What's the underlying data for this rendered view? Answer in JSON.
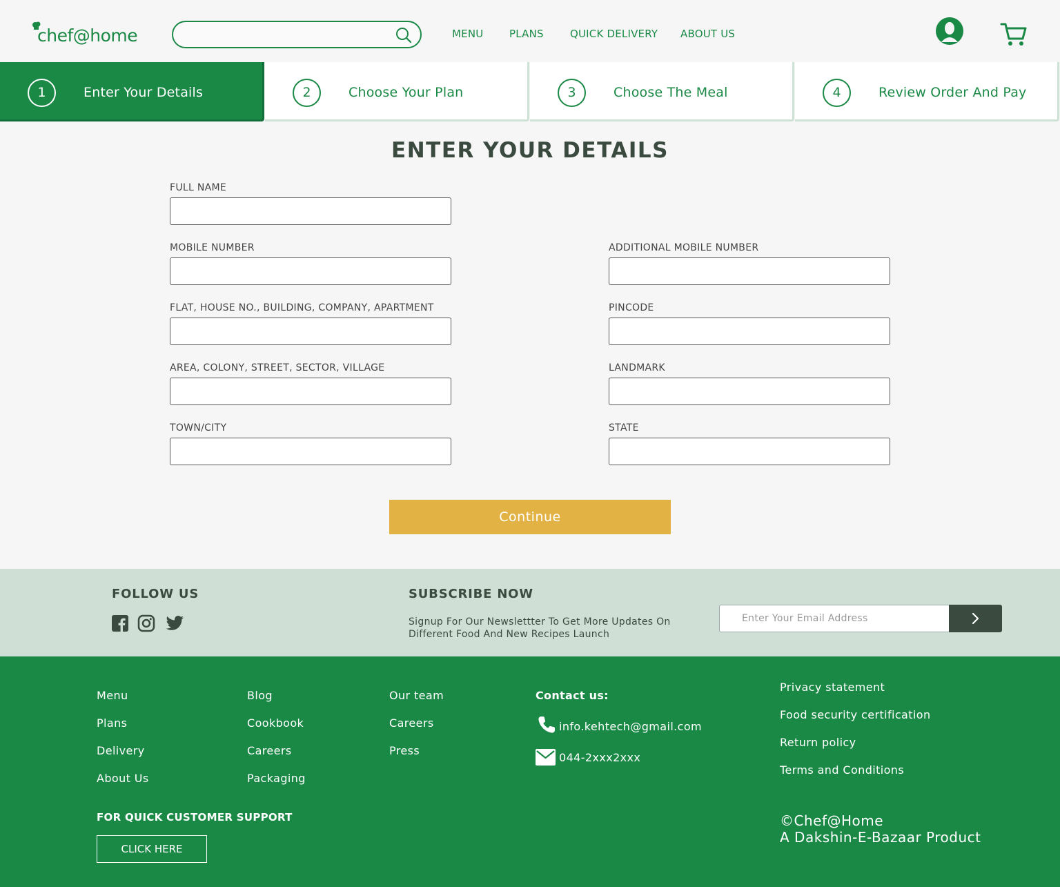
{
  "header": {
    "logo": "chef@home",
    "search": {
      "value": "",
      "placeholder": ""
    },
    "nav": [
      "MENU",
      "PLANS",
      "QUICK DELIVERY",
      "ABOUT US"
    ]
  },
  "steps": [
    {
      "num": "1",
      "label": "Enter Your Details",
      "active": true
    },
    {
      "num": "2",
      "label": "Choose Your Plan",
      "active": false
    },
    {
      "num": "3",
      "label": "Choose The Meal",
      "active": false
    },
    {
      "num": "4",
      "label": "Review Order And Pay",
      "active": false
    }
  ],
  "form": {
    "title": "ENTER YOUR DETAILS",
    "fields": {
      "full_name": "FULL NAME",
      "mobile": "MOBILE NUMBER",
      "additional_mobile": "ADDITIONAL MOBILE NUMBER",
      "flat": "FLAT, HOUSE NO., BUILDING, COMPANY, APARTMENT",
      "pincode": "PINCODE",
      "area": "AREA, COLONY, STREET, SECTOR, VILLAGE",
      "landmark": "LANDMARK",
      "town": "TOWN/CITY",
      "state": "STATE"
    },
    "continue_label": "Continue"
  },
  "band": {
    "follow_title": "FOLLOW US",
    "subscribe_title": "SUBSCRIBE NOW",
    "subscribe_text": "Signup For Our Newslettter To Get More Updates On Different Food And New Recipes Launch",
    "email_placeholder": "Enter Your Email Address"
  },
  "footer": {
    "col1": [
      "Menu",
      "Plans",
      "Delivery",
      "About Us"
    ],
    "col2": [
      "Blog",
      "Cookbook",
      "Careers",
      "Packaging"
    ],
    "col3": [
      "Our team",
      "Careers",
      "Press"
    ],
    "contact_title": "Contact us:",
    "email": "info.kehtech@gmail.com",
    "phone": "044-2xxx2xxx",
    "col5": [
      "Privacy statement",
      "Food security certification",
      "Return policy",
      "Terms and Conditions"
    ],
    "support_title": "FOR QUICK CUSTOMER SUPPORT",
    "click_here": "CLICK HERE",
    "copyright": "©Chef@Home",
    "product": "A Dakshin-E-Bazaar Product"
  },
  "colors": {
    "brand_green": "#1b8946",
    "button_gold": "#e2b244",
    "band": "#cfdfd6",
    "dark": "#3a4a3f"
  }
}
